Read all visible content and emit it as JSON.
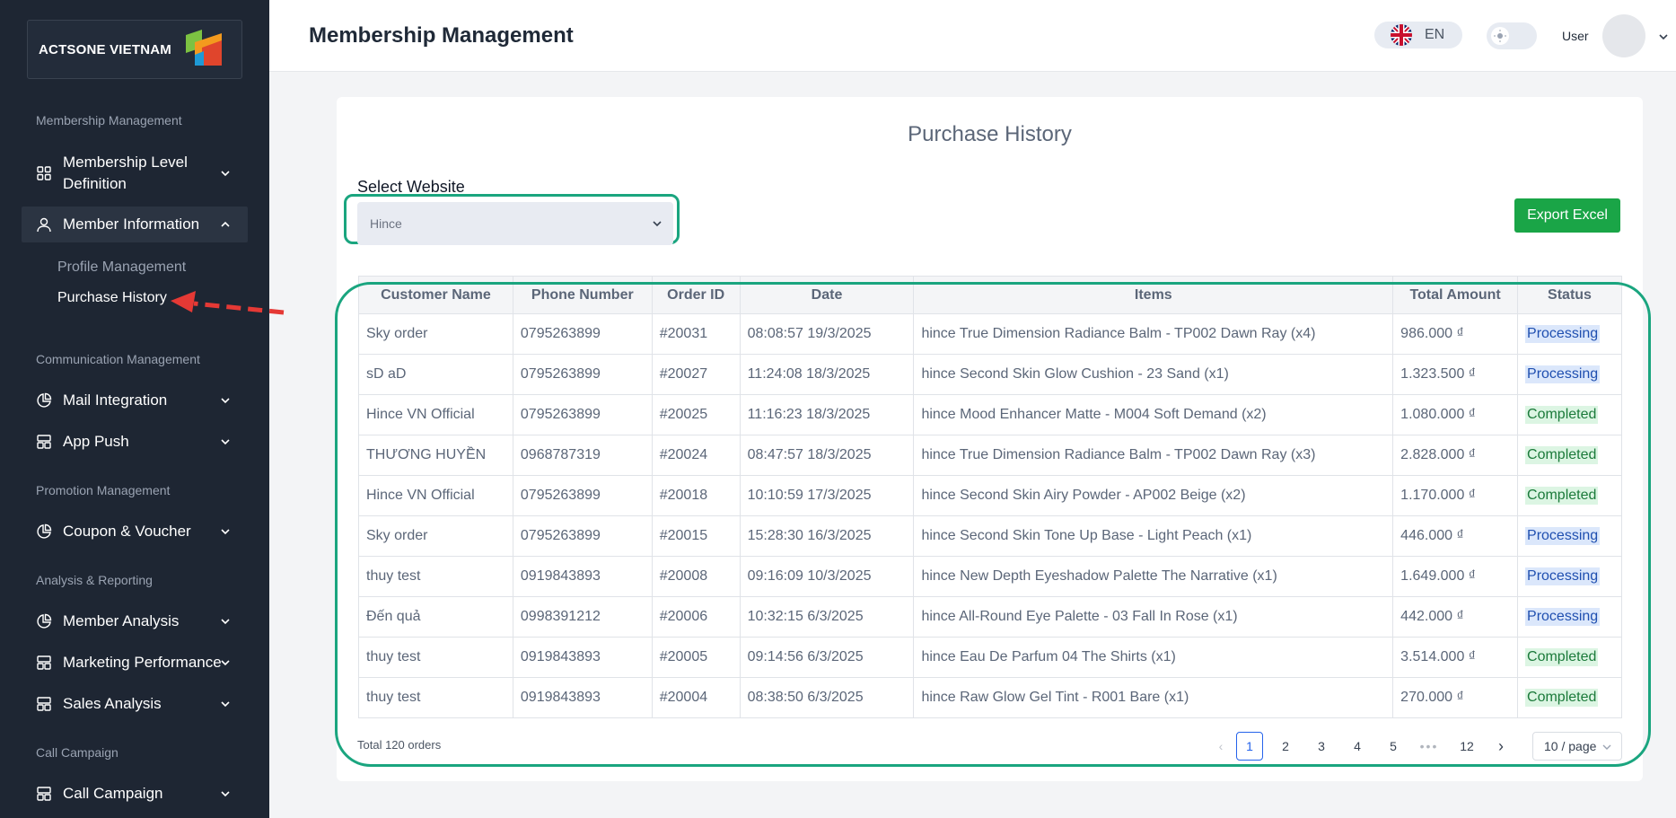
{
  "sidebar": {
    "logo_text": "ACTSONE VIETNAM",
    "sections": {
      "membership": "Membership Management",
      "communication": "Communication Management",
      "promotion": "Promotion Management",
      "analysis": "Analysis & Reporting",
      "call": "Call Campaign"
    },
    "items": {
      "level_definition": "Membership Level Definition",
      "member_information": "Member Information",
      "profile_management": "Profile Management",
      "purchase_history": "Purchase History",
      "mail_integration": "Mail Integration",
      "app_push": "App Push",
      "coupon_voucher": "Coupon & Voucher",
      "member_analysis": "Member Analysis",
      "marketing_performance": "Marketing Performance",
      "sales_analysis": "Sales Analysis",
      "call_campaign": "Call Campaign"
    }
  },
  "header": {
    "title": "Membership Management",
    "language": "EN",
    "user_label": "User"
  },
  "main": {
    "title": "Purchase History",
    "select_label": "Select Website",
    "selected_website": "Hince",
    "export_label": "Export Excel",
    "columns": [
      "Customer Name",
      "Phone Number",
      "Order ID",
      "Date",
      "Items",
      "Total Amount",
      "Status"
    ],
    "rows": [
      {
        "name": "Sky order",
        "phone": "0795263899",
        "order": "#20031",
        "date": "08:08:57 19/3/2025",
        "items": "hince True Dimension Radiance Balm - TP002 Dawn Ray (x4)",
        "amount": "986.000 ₫",
        "status": "Processing"
      },
      {
        "name": "sD aD",
        "phone": "0795263899",
        "order": "#20027",
        "date": "11:24:08 18/3/2025",
        "items": "hince Second Skin Glow Cushion - 23 Sand (x1)",
        "amount": "1.323.500 ₫",
        "status": "Processing"
      },
      {
        "name": "Hince VN Official",
        "phone": "0795263899",
        "order": "#20025",
        "date": "11:16:23 18/3/2025",
        "items": "hince Mood Enhancer Matte - M004 Soft Demand (x2)",
        "amount": "1.080.000 ₫",
        "status": "Completed"
      },
      {
        "name": "THƯƠNG HUYỀN",
        "phone": "0968787319",
        "order": "#20024",
        "date": "08:47:57 18/3/2025",
        "items": "hince True Dimension Radiance Balm - TP002 Dawn Ray (x3)",
        "amount": "2.828.000 ₫",
        "status": "Completed"
      },
      {
        "name": "Hince VN Official",
        "phone": "0795263899",
        "order": "#20018",
        "date": "10:10:59 17/3/2025",
        "items": "hince Second Skin Airy Powder - AP002 Beige (x2)",
        "amount": "1.170.000 ₫",
        "status": "Completed"
      },
      {
        "name": "Sky order",
        "phone": "0795263899",
        "order": "#20015",
        "date": "15:28:30 16/3/2025",
        "items": "hince Second Skin Tone Up Base - Light Peach (x1)",
        "amount": "446.000 ₫",
        "status": "Processing"
      },
      {
        "name": "thuy test",
        "phone": "0919843893",
        "order": "#20008",
        "date": "09:16:09 10/3/2025",
        "items": "hince New Depth Eyeshadow Palette The Narrative (x1)",
        "amount": "1.649.000 ₫",
        "status": "Processing"
      },
      {
        "name": "Đến quả",
        "phone": "0998391212",
        "order": "#20006",
        "date": "10:32:15 6/3/2025",
        "items": "hince All-Round Eye Palette - 03 Fall In Rose (x1)",
        "amount": "442.000 ₫",
        "status": "Processing"
      },
      {
        "name": "thuy test",
        "phone": "0919843893",
        "order": "#20005",
        "date": "09:14:56 6/3/2025",
        "items": "hince Eau De Parfum 04 The Shirts (x1)",
        "amount": "3.514.000 ₫",
        "status": "Completed"
      },
      {
        "name": "thuy test",
        "phone": "0919843893",
        "order": "#20004",
        "date": "08:38:50 6/3/2025",
        "items": "hince Raw Glow Gel Tint - R001 Bare (x1)",
        "amount": "270.000 ₫",
        "status": "Completed"
      }
    ],
    "total_text": "Total 120 orders",
    "pagination": {
      "pages": [
        "1",
        "2",
        "3",
        "4",
        "5"
      ],
      "dots": "•••",
      "last": "12",
      "prev": "‹",
      "next": "›",
      "page_size": "10 / page"
    }
  },
  "colors": {
    "sidebar_bg": "#1e2633",
    "highlight": "#1aa57f",
    "export_button": "#1aa547",
    "arrow": "#e53935"
  }
}
